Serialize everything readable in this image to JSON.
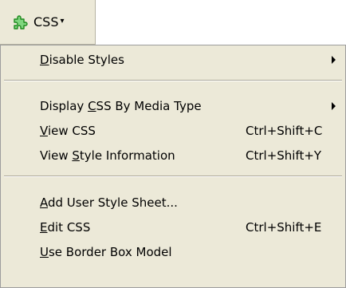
{
  "toolbar": {
    "icon": "puzzle-piece-icon",
    "label": "CSS",
    "caret": "▾"
  },
  "menu": {
    "items": [
      {
        "label_pre": "",
        "label_u": "D",
        "label_post": "isable Styles",
        "shortcut": "",
        "submenu": true
      },
      {
        "label_pre": "Display ",
        "label_u": "C",
        "label_post": "SS By Media Type",
        "shortcut": "",
        "submenu": true
      },
      {
        "label_pre": "",
        "label_u": "V",
        "label_post": "iew CSS",
        "shortcut": "Ctrl+Shift+C",
        "submenu": false
      },
      {
        "label_pre": "View ",
        "label_u": "S",
        "label_post": "tyle Information",
        "shortcut": "Ctrl+Shift+Y",
        "submenu": false
      },
      {
        "label_pre": "",
        "label_u": "A",
        "label_post": "dd User Style Sheet...",
        "shortcut": "",
        "submenu": false
      },
      {
        "label_pre": "",
        "label_u": "E",
        "label_post": "dit CSS",
        "shortcut": "Ctrl+Shift+E",
        "submenu": false
      },
      {
        "label_pre": "",
        "label_u": "U",
        "label_post": "se Border Box Model",
        "shortcut": "",
        "submenu": false
      }
    ]
  },
  "colors": {
    "menu_bg": "#ece9d8",
    "icon_green": "#38a838"
  }
}
